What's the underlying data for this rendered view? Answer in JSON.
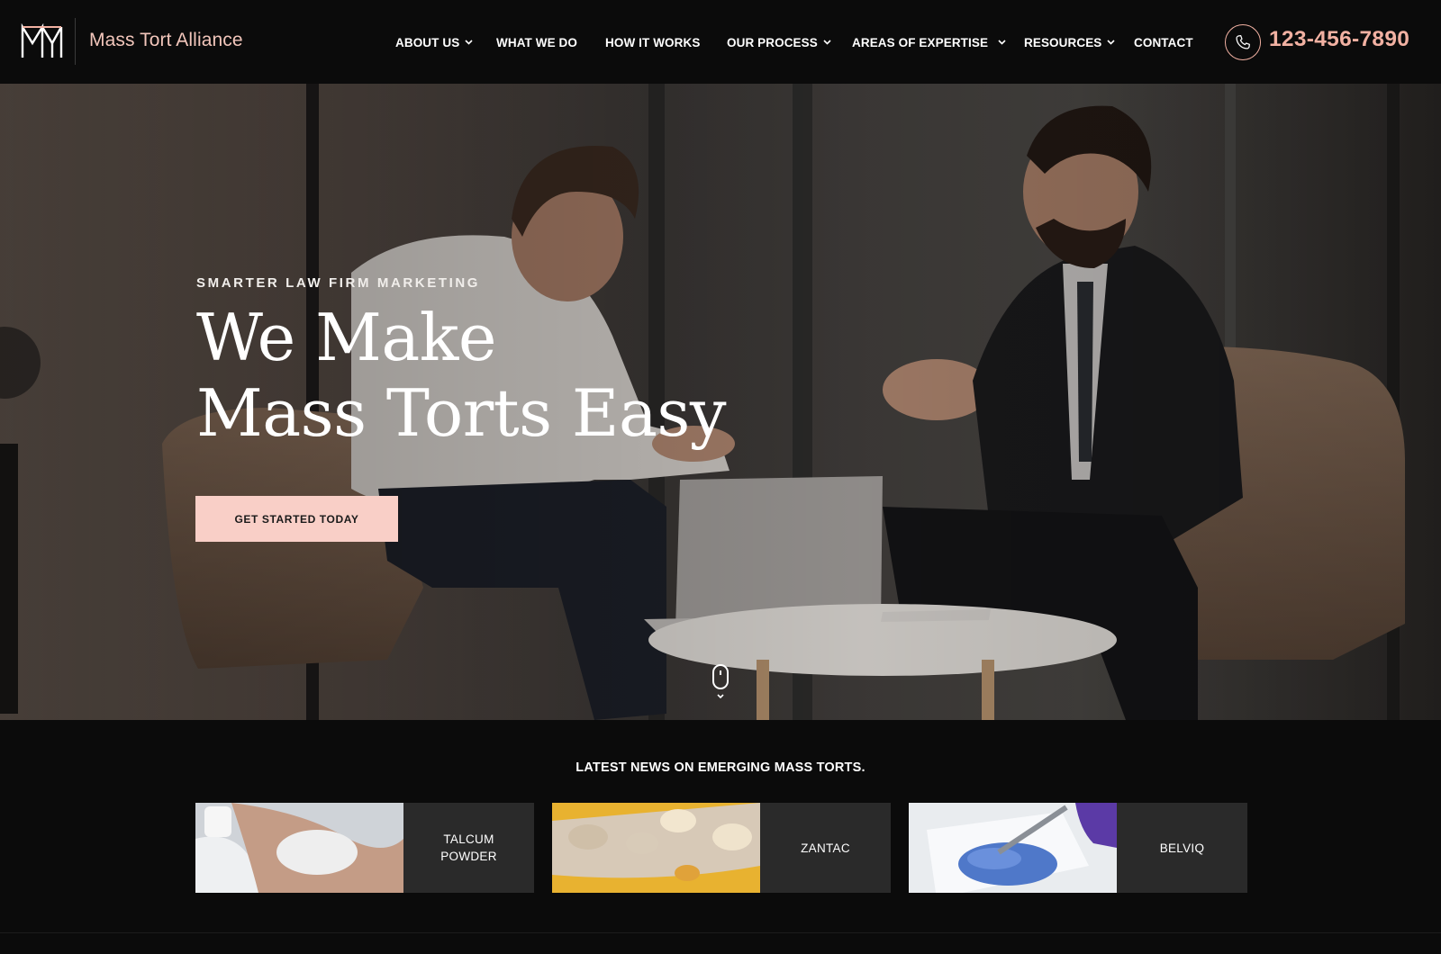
{
  "header": {
    "brand": "Mass Tort Alliance",
    "nav": [
      {
        "label": "ABOUT US",
        "dropdown": true
      },
      {
        "label": "WHAT WE DO",
        "dropdown": false
      },
      {
        "label": "HOW IT WORKS",
        "dropdown": false
      },
      {
        "label": "OUR PROCESS",
        "dropdown": true
      },
      {
        "label": "AREAS OF EXPERTISE",
        "dropdown": true
      },
      {
        "label": "RESOURCES",
        "dropdown": true
      },
      {
        "label": "CONTACT",
        "dropdown": false
      }
    ],
    "phone": "123-456-7890",
    "phone_icon": "phone-icon"
  },
  "hero": {
    "eyebrow": "SMARTER LAW FIRM MARKETING",
    "title_line1": "We Make",
    "title_line2": "Mass Torts Easy",
    "cta": "GET STARTED TODAY"
  },
  "news": {
    "heading": "LATEST NEWS ON EMERGING MASS TORTS.",
    "cards": [
      {
        "label_line1": "TALCUM",
        "label_line2": "POWDER"
      },
      {
        "label_line1": "ZANTAC",
        "label_line2": ""
      },
      {
        "label_line1": "BELVIQ",
        "label_line2": ""
      }
    ]
  },
  "colors": {
    "accent": "#f2b1a2",
    "cta_bg": "#f9cfc7",
    "background": "#0b0b0b",
    "card_bg": "#2a2a2a"
  }
}
